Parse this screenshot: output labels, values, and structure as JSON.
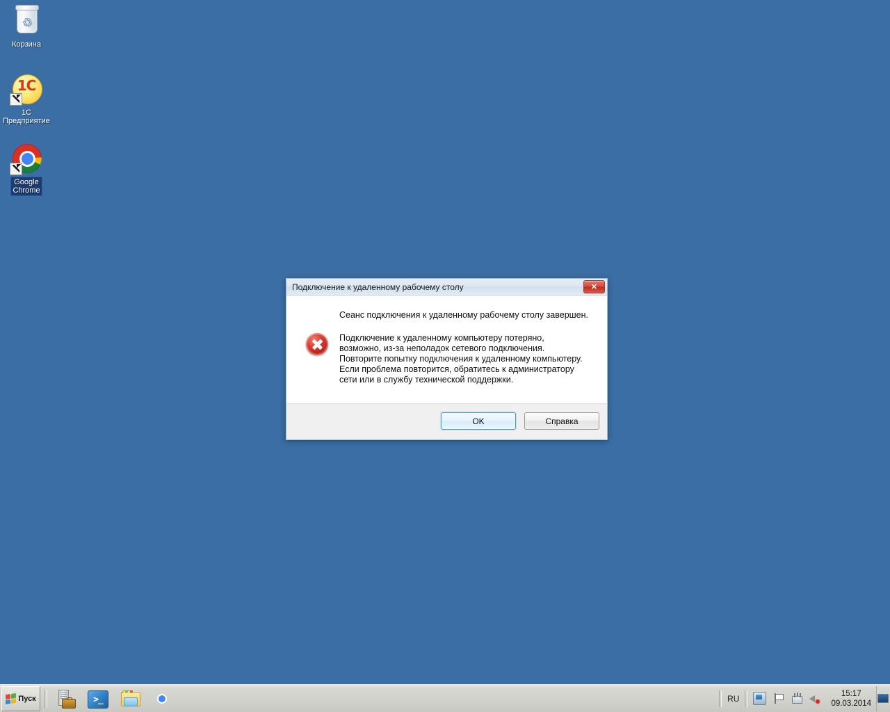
{
  "desktop": {
    "background_color": "#3b6ea5",
    "icons": [
      {
        "name": "recycle-bin",
        "icon": "recycle-bin-icon",
        "label": "Корзина",
        "selected": false,
        "shortcut": false
      },
      {
        "name": "1c-enterprise",
        "icon": "1c-icon",
        "label": "1C\nПредприятие",
        "label_line1": "1C",
        "label_line2": "Предприятие",
        "selected": false,
        "shortcut": true
      },
      {
        "name": "google-chrome",
        "icon": "chrome-icon",
        "label": "Google\nChrome",
        "label_line1": "Google",
        "label_line2": "Chrome",
        "selected": true,
        "shortcut": true
      }
    ]
  },
  "dialog": {
    "title": "Подключение к удаленному рабочему столу",
    "close_label": "✕",
    "icon": "error-icon",
    "heading": "Сеанс подключения к удаленному рабочему столу завершен.",
    "body": "Подключение к удаленному компьютеру потеряно, возможно, из-за неполадок сетевого подключения. Повторите попытку подключения к удаленному компьютеру. Если проблема повторится, обратитесь к администратору сети или в службу технической поддержки.",
    "buttons": {
      "ok": "OK",
      "help": "Справка"
    },
    "accent_color": "#3c9dd4",
    "error_color": "#d9362a"
  },
  "taskbar": {
    "start_label": "Пуск",
    "quicklaunch": [
      {
        "name": "server-manager",
        "icon": "server-manager-icon"
      },
      {
        "name": "powershell",
        "icon": "powershell-icon",
        "glyph": ">_"
      },
      {
        "name": "windows-explorer",
        "icon": "folder-icon"
      },
      {
        "name": "google-chrome",
        "icon": "chrome-icon"
      }
    ],
    "tray": {
      "language": "RU",
      "icons": [
        {
          "name": "network-status",
          "icon": "network-status-icon"
        },
        {
          "name": "action-center",
          "icon": "flag-icon"
        },
        {
          "name": "network-connection",
          "icon": "network-connection-icon"
        },
        {
          "name": "volume-muted",
          "icon": "speaker-muted-icon"
        }
      ],
      "clock_time": "15:17",
      "clock_date": "09.03.2014",
      "show_desktop": "show-desktop-icon"
    }
  }
}
